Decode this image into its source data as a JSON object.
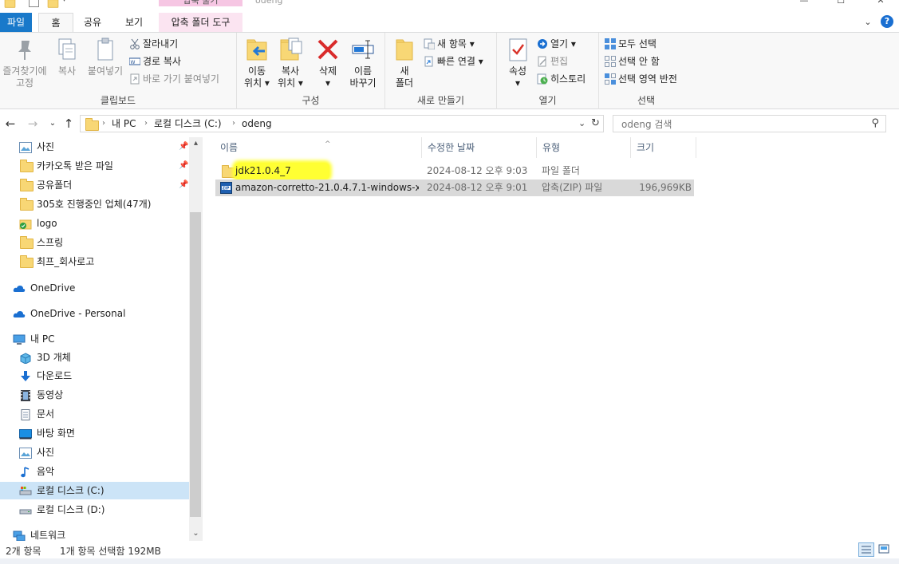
{
  "window": {
    "title": "odeng",
    "context_header": "압축 풀기"
  },
  "tabs": [
    {
      "label": "파일"
    },
    {
      "label": "홈"
    },
    {
      "label": "공유"
    },
    {
      "label": "보기"
    },
    {
      "label": "압축 폴더 도구"
    }
  ],
  "ribbon": {
    "clipboard": {
      "label": "클립보드",
      "pin_quick_access_l1": "즐겨찾기에",
      "pin_quick_access_l2": "고정",
      "copy": "복사",
      "paste": "붙여넣기",
      "cut": "잘라내기",
      "copy_path": "경로 복사",
      "paste_shortcut": "바로 가기 붙여넣기"
    },
    "organize": {
      "label": "구성",
      "move_to_l1": "이동",
      "move_to_l2": "위치 ▾",
      "copy_to_l1": "복사",
      "copy_to_l2": "위치 ▾",
      "delete_l1": "삭제",
      "delete_l2": "▾",
      "rename_l1": "이름",
      "rename_l2": "바꾸기"
    },
    "new": {
      "label": "새로 만들기",
      "new_folder_l1": "새",
      "new_folder_l2": "폴더",
      "new_item": "새 항목 ▾",
      "easy_access": "빠른 연결 ▾"
    },
    "open": {
      "label": "열기",
      "properties_l1": "속성",
      "properties_l2": "▾",
      "open": "열기 ▾",
      "edit": "편집",
      "history": "히스토리"
    },
    "select": {
      "label": "선택",
      "select_all": "모두 선택",
      "select_none": "선택 안 함",
      "invert": "선택 영역 반전"
    }
  },
  "address": {
    "crumbs": [
      "내 PC",
      "로컬 디스크 (C:)",
      "odeng"
    ],
    "search_placeholder": "odeng 검색"
  },
  "nav": {
    "quick_access": [
      {
        "label": "사진",
        "pinned": true
      },
      {
        "label": "카카오톡 받은 파일",
        "pinned": true
      },
      {
        "label": "공유폴더",
        "pinned": true
      },
      {
        "label": "305호 진행중인 업체(47개)",
        "pinned": false
      },
      {
        "label": "logo",
        "pinned": false
      },
      {
        "label": "스프링",
        "pinned": false
      },
      {
        "label": "최프_회사로고",
        "pinned": false
      }
    ],
    "onedrive": "OneDrive",
    "onedrive_personal": "OneDrive - Personal",
    "this_pc": "내 PC",
    "pc_items": [
      {
        "label": "3D 개체"
      },
      {
        "label": "다운로드"
      },
      {
        "label": "동영상"
      },
      {
        "label": "문서"
      },
      {
        "label": "바탕 화면"
      },
      {
        "label": "사진"
      },
      {
        "label": "음악"
      },
      {
        "label": "로컬 디스크 (C:)"
      },
      {
        "label": "로컬 디스크 (D:)"
      }
    ],
    "network": "네트워크"
  },
  "columns": {
    "name": "이름",
    "date": "수정한 날짜",
    "type": "유형",
    "size": "크기"
  },
  "files": [
    {
      "name": "jdk21.0.4_7",
      "date": "2024-08-12 오후 9:03",
      "type": "파일 폴더",
      "size": ""
    },
    {
      "name": "amazon-corretto-21.0.4.7.1-windows-x...",
      "date": "2024-08-12 오후 9:01",
      "type": "압축(ZIP) 파일",
      "size": "196,969KB"
    }
  ],
  "status": {
    "count": "2개 항목",
    "selection": "1개 항목 선택함 192MB"
  },
  "colors": {
    "accent": "#1979ca",
    "selection": "#cce4f7",
    "context_tab": "#f6c6e3",
    "highlight": "#ffff33"
  }
}
